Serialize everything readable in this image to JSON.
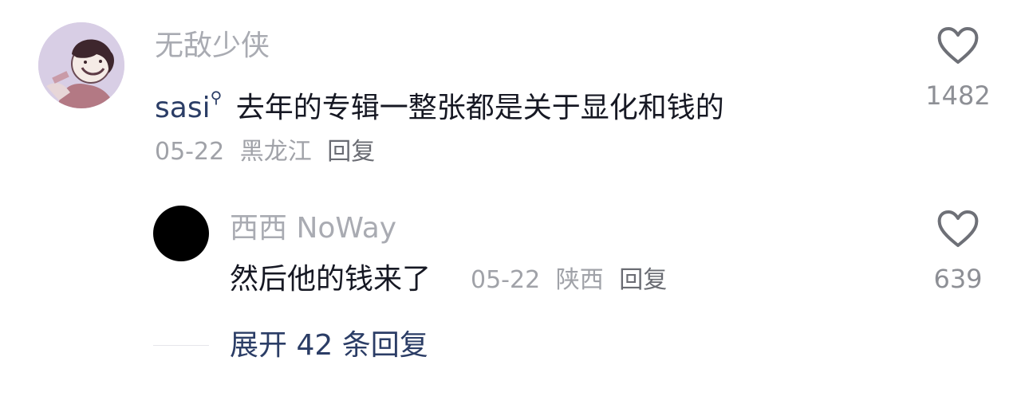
{
  "comment": {
    "username": "无敌少侠",
    "mention": "sasi",
    "text": "去年的专辑一整张都是关于显化和钱的",
    "date": "05-22",
    "location": "黑龙江",
    "reply_label": "回复",
    "like_count": "1482"
  },
  "reply": {
    "username": "西西 NoWay",
    "text": "然后他的钱来了",
    "date": "05-22",
    "location": "陕西",
    "reply_label": "回复",
    "like_count": "639"
  },
  "expand": {
    "label": "展开 42 条回复"
  },
  "icons": {
    "like": "heart-outline-icon",
    "mention": "search-icon",
    "avatar_main": "cartoon-avatar",
    "avatar_reply": "black-avatar"
  },
  "colors": {
    "text": "#161823",
    "muted": "#a9abb2",
    "mention": "#2b3d66",
    "icon": "#777980"
  }
}
